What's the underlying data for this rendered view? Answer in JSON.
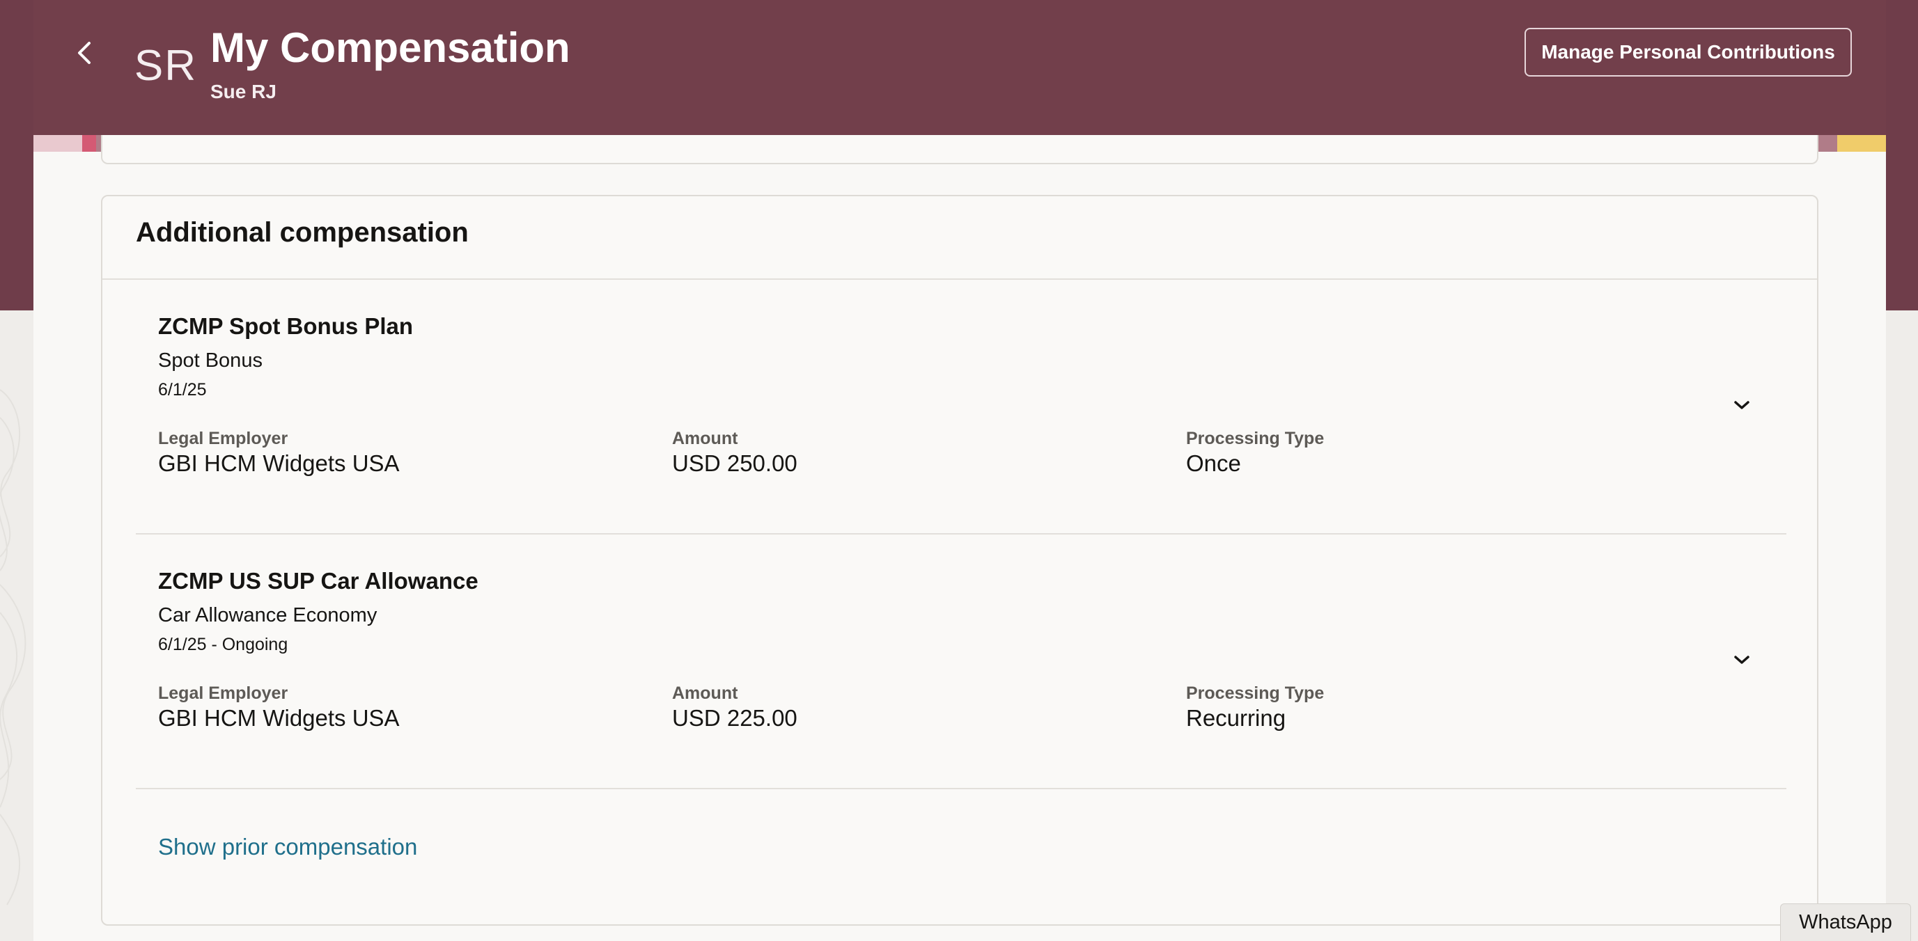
{
  "header": {
    "back_icon": "chevron-left-icon",
    "avatar_initials": "SR",
    "title": "My Compensation",
    "subtitle": "Sue RJ",
    "manage_button": "Manage Personal Contributions",
    "background_color": "#723f4b"
  },
  "card": {
    "title": "Additional compensation",
    "items": [
      {
        "name": "ZCMP Spot Bonus Plan",
        "subtitle": "Spot Bonus",
        "date": "6/1/25",
        "fields": [
          {
            "label": "Legal Employer",
            "value": "GBI HCM Widgets USA"
          },
          {
            "label": "Amount",
            "value": "USD 250.00"
          },
          {
            "label": "Processing Type",
            "value": "Once"
          }
        ],
        "expand_icon": "chevron-down-icon"
      },
      {
        "name": "ZCMP US SUP Car Allowance",
        "subtitle": "Car Allowance Economy",
        "date": "6/1/25 - Ongoing",
        "fields": [
          {
            "label": "Legal Employer",
            "value": "GBI HCM Widgets USA"
          },
          {
            "label": "Amount",
            "value": "USD 225.00"
          },
          {
            "label": "Processing Type",
            "value": "Recurring"
          }
        ],
        "expand_icon": "chevron-down-icon"
      }
    ],
    "prior_link": "Show prior compensation",
    "link_color": "#1f6f8b"
  },
  "floating": {
    "whatsapp_label": "WhatsApp"
  }
}
